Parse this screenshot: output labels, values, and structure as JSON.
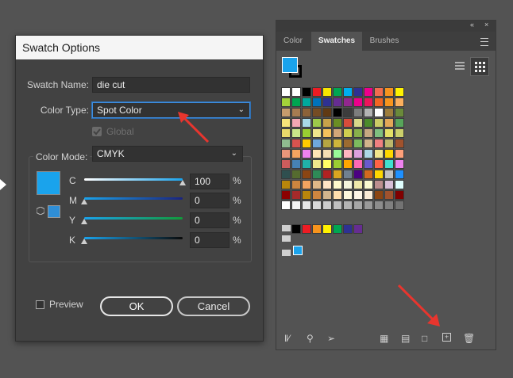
{
  "dialog": {
    "title": "Swatch Options",
    "swatch_name_label": "Swatch Name:",
    "swatch_name_value": "die cut",
    "color_type_label": "Color Type:",
    "color_type_value": "Spot Color",
    "global_label": "Global",
    "color_mode_label": "Color Mode:",
    "color_mode_value": "CMYK",
    "preview_label": "Preview",
    "ok_label": "OK",
    "cancel_label": "Cancel",
    "swatch_color": "#1aa3ec",
    "channels": [
      {
        "name": "C",
        "value": "100",
        "unit": "%"
      },
      {
        "name": "M",
        "value": "0",
        "unit": "%"
      },
      {
        "name": "Y",
        "value": "0",
        "unit": "%"
      },
      {
        "name": "K",
        "value": "0",
        "unit": "%"
      }
    ]
  },
  "panel": {
    "tabs": [
      "Color",
      "Swatches",
      "Brushes"
    ],
    "active_tab": "Swatches",
    "fill_color": "#1aa3ec",
    "swatch_rows": [
      [
        "#ffffff",
        "#ffffff",
        "#000000",
        "#ed1c24",
        "#f7e600",
        "#00a651",
        "#00aeef",
        "#2e3192",
        "#ec008c",
        "#f26c4f",
        "#f7941d",
        "#fff200"
      ],
      [
        "#a3d33a",
        "#00a651",
        "#00a99d",
        "#0072bc",
        "#2e3192",
        "#662d91",
        "#92278f",
        "#ec008c",
        "#ed145b",
        "#f26522",
        "#f7941d",
        "#fbaf5d"
      ],
      [
        "#c69c6d",
        "#a67c52",
        "#8c6239",
        "#754c24",
        "#603913",
        "#000000",
        "#3c3c3c",
        "#7d7d7d",
        "#b3b3b3",
        "#ffffff",
        "#9e7e3c",
        "#6a8a3a"
      ],
      [
        "#f6e37a",
        "#f2a6b4",
        "#a8d8e8",
        "#9dc94a",
        "#c8a24a",
        "#6b8e23",
        "#d64c3b",
        "#d9d98a",
        "#4c8c2b",
        "#cccc66",
        "#e3a857",
        "#57a55a"
      ],
      [
        "#e8d96a",
        "#c9e58a",
        "#9acd32",
        "#f0e68c",
        "#f4c15c",
        "#d2a679",
        "#cfcf4f",
        "#88b04b",
        "#c8a882",
        "#7fbf7f",
        "#e4e066",
        "#ccd06b"
      ],
      [
        "#8fbc8f",
        "#d9534f",
        "#ffcc00",
        "#6fa8dc",
        "#b5a642",
        "#cfb53b",
        "#9c6b30",
        "#7cbb5e",
        "#d2b48c",
        "#f08080",
        "#bdb76b",
        "#a0522d"
      ],
      [
        "#e9967a",
        "#f4a460",
        "#ee82ee",
        "#ffe4b5",
        "#f5deb3",
        "#98fb98",
        "#ffb6c1",
        "#dda0dd",
        "#add8e6",
        "#f0e68c",
        "#ffd700",
        "#ffa07a"
      ],
      [
        "#cd5c5c",
        "#4682b4",
        "#20b2aa",
        "#f0e68c",
        "#ffff66",
        "#9acd32",
        "#ffa500",
        "#ff69b4",
        "#6a5acd",
        "#ff6347",
        "#40e0d0",
        "#ee82ee"
      ],
      [
        "#2f4f4f",
        "#556b2f",
        "#8b4513",
        "#2e8b57",
        "#b22222",
        "#daa520",
        "#708090",
        "#4b0082",
        "#d2691e",
        "#ffd700",
        "#c0c0c0",
        "#1e90ff"
      ],
      [
        "#b8860b",
        "#cd853f",
        "#f4a460",
        "#deb887",
        "#ffe4c4",
        "#fffacd",
        "#f5f5dc",
        "#eee8aa",
        "#fafad2",
        "#bc8f8f",
        "#d8bfd8",
        "#e0ffff"
      ],
      [
        "#8b0000",
        "#a52a2a",
        "#b8860b",
        "#cd853f",
        "#d2b48c",
        "#ffdead",
        "#fff8dc",
        "#fdf5e6",
        "#faebd7",
        "#8b4513",
        "#a0522d",
        "#800000"
      ],
      [
        "#ffffff",
        "#f2f2f2",
        "#e6e6e6",
        "#d9d9d9",
        "#cccccc",
        "#bfbfbf",
        "#b3b3b3",
        "#a6a6a6",
        "#999999",
        "#8c8c8c",
        "#808080",
        "#737373"
      ],
      [
        "#000000",
        "#ed1c24",
        "#f7941d",
        "#fff200",
        "#00a651",
        "#2e3192",
        "#662d91"
      ]
    ]
  }
}
